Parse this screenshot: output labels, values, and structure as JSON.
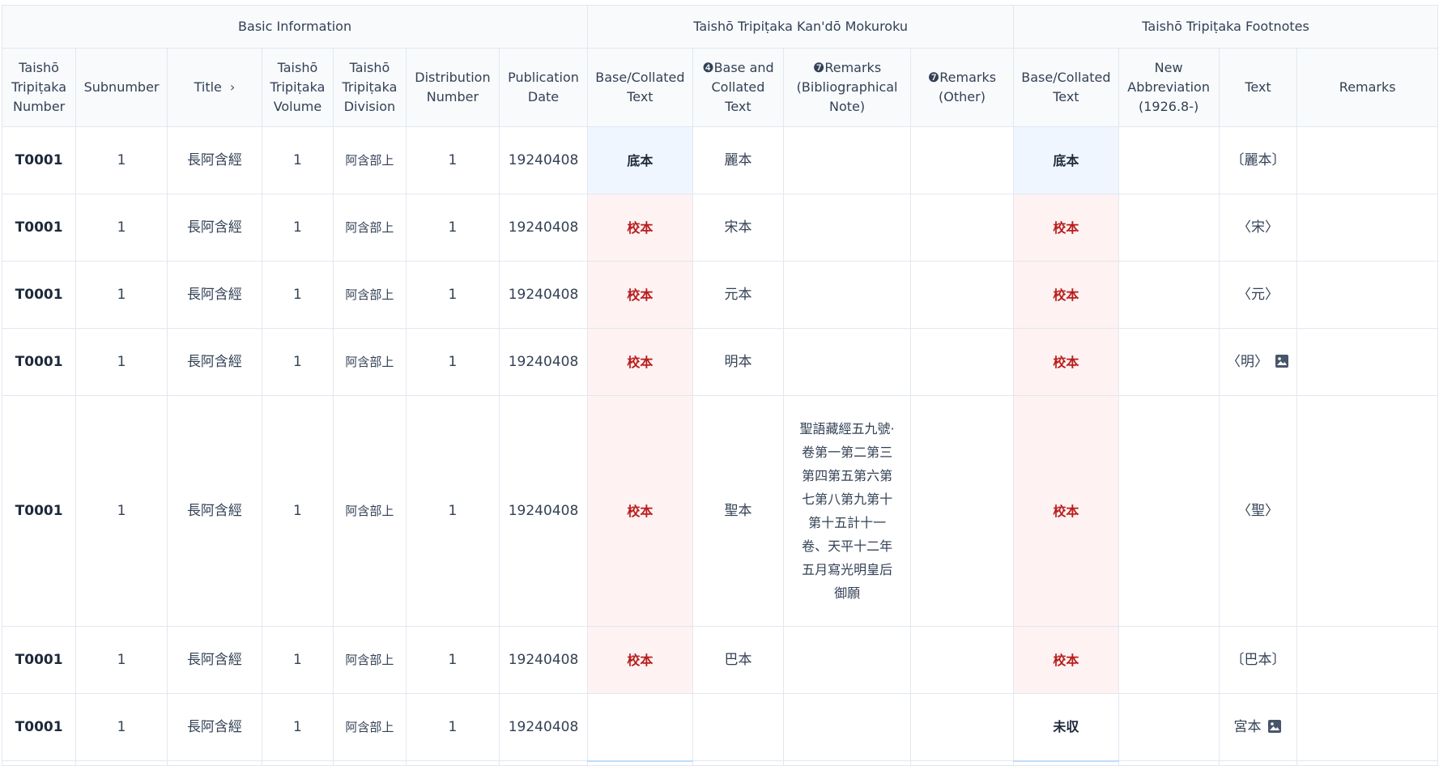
{
  "groups": {
    "basic": "Basic Information",
    "kando": "Taishō Tripiṭaka Kan'dō Mokuroku",
    "footnotes": "Taishō Tripiṭaka Footnotes"
  },
  "columns": {
    "number": "Taishō Tripiṭaka Number",
    "subnumber": "Subnumber",
    "title": "Title",
    "volume": "Taishō Tripiṭaka Volume",
    "division": "Taishō Tripiṭaka Division",
    "distribution": "Distribution Number",
    "pubdate": "Publication Date",
    "k_base": "Base/Collated Text",
    "k_base_and": "❹Base and Collated Text",
    "k_remarks_bib": "❼Remarks (Bibliographical Note)",
    "k_remarks_other": "❼Remarks (Other)",
    "f_base": "Base/Collated Text",
    "f_abbr": "New Abbreviation (1926.8-)",
    "f_text": "Text",
    "f_remarks": "Remarks"
  },
  "icons": {
    "title_sort": "chevron-right-icon",
    "image": "image-icon"
  },
  "rows": [
    {
      "number": "T0001",
      "subnumber": "1",
      "title": "長阿含經",
      "volume": "1",
      "division": "阿含部上",
      "distribution": "1",
      "pubdate": "19240408",
      "k_base": "底本",
      "k_base_kind": "base",
      "k_base_and": "麗本",
      "k_remarks_bib": "",
      "k_remarks_other": "",
      "f_base": "底本",
      "f_base_kind": "base",
      "f_abbr": "",
      "f_text": "〔麗本〕",
      "f_image": false,
      "f_remarks": ""
    },
    {
      "number": "T0001",
      "subnumber": "1",
      "title": "長阿含經",
      "volume": "1",
      "division": "阿含部上",
      "distribution": "1",
      "pubdate": "19240408",
      "k_base": "校本",
      "k_base_kind": "coll",
      "k_base_and": "宋本",
      "k_remarks_bib": "",
      "k_remarks_other": "",
      "f_base": "校本",
      "f_base_kind": "coll",
      "f_abbr": "",
      "f_text": "〈宋〉",
      "f_image": false,
      "f_remarks": ""
    },
    {
      "number": "T0001",
      "subnumber": "1",
      "title": "長阿含經",
      "volume": "1",
      "division": "阿含部上",
      "distribution": "1",
      "pubdate": "19240408",
      "k_base": "校本",
      "k_base_kind": "coll",
      "k_base_and": "元本",
      "k_remarks_bib": "",
      "k_remarks_other": "",
      "f_base": "校本",
      "f_base_kind": "coll",
      "f_abbr": "",
      "f_text": "〈元〉",
      "f_image": false,
      "f_remarks": ""
    },
    {
      "number": "T0001",
      "subnumber": "1",
      "title": "長阿含經",
      "volume": "1",
      "division": "阿含部上",
      "distribution": "1",
      "pubdate": "19240408",
      "k_base": "校本",
      "k_base_kind": "coll",
      "k_base_and": "明本",
      "k_remarks_bib": "",
      "k_remarks_other": "",
      "f_base": "校本",
      "f_base_kind": "coll",
      "f_abbr": "",
      "f_text": "〈明〉",
      "f_image": true,
      "f_remarks": ""
    },
    {
      "number": "T0001",
      "subnumber": "1",
      "title": "長阿含經",
      "volume": "1",
      "division": "阿含部上",
      "distribution": "1",
      "pubdate": "19240408",
      "k_base": "校本",
      "k_base_kind": "coll",
      "k_base_and": "聖本",
      "k_remarks_bib": "聖語藏經五九號·卷第一第二第三第四第五第六第七第八第九第十第十五計十一卷、天平十二年五月寫光明皇后御願",
      "k_remarks_other": "",
      "f_base": "校本",
      "f_base_kind": "coll",
      "f_abbr": "",
      "f_text": "〈聖〉",
      "f_image": false,
      "f_remarks": ""
    },
    {
      "number": "T0001",
      "subnumber": "1",
      "title": "長阿含經",
      "volume": "1",
      "division": "阿含部上",
      "distribution": "1",
      "pubdate": "19240408",
      "k_base": "校本",
      "k_base_kind": "coll",
      "k_base_and": "巴本",
      "k_remarks_bib": "",
      "k_remarks_other": "",
      "f_base": "校本",
      "f_base_kind": "coll",
      "f_abbr": "",
      "f_text": "〔巴本〕",
      "f_image": false,
      "f_remarks": ""
    },
    {
      "number": "T0001",
      "subnumber": "1",
      "title": "長阿含經",
      "volume": "1",
      "division": "阿含部上",
      "distribution": "1",
      "pubdate": "19240408",
      "k_base": "",
      "k_base_kind": "none",
      "k_base_and": "",
      "k_remarks_bib": "",
      "k_remarks_other": "",
      "f_base": "未収",
      "f_base_kind": "unc",
      "f_abbr": "",
      "f_text": "宮本",
      "f_image": true,
      "f_remarks": ""
    }
  ],
  "colors": {
    "base_bg": "#eff6ff",
    "coll_bg": "#fef2f2",
    "coll_text": "#b91c1c",
    "header_bg": "#f8fafc",
    "border": "#e2e8f0"
  }
}
